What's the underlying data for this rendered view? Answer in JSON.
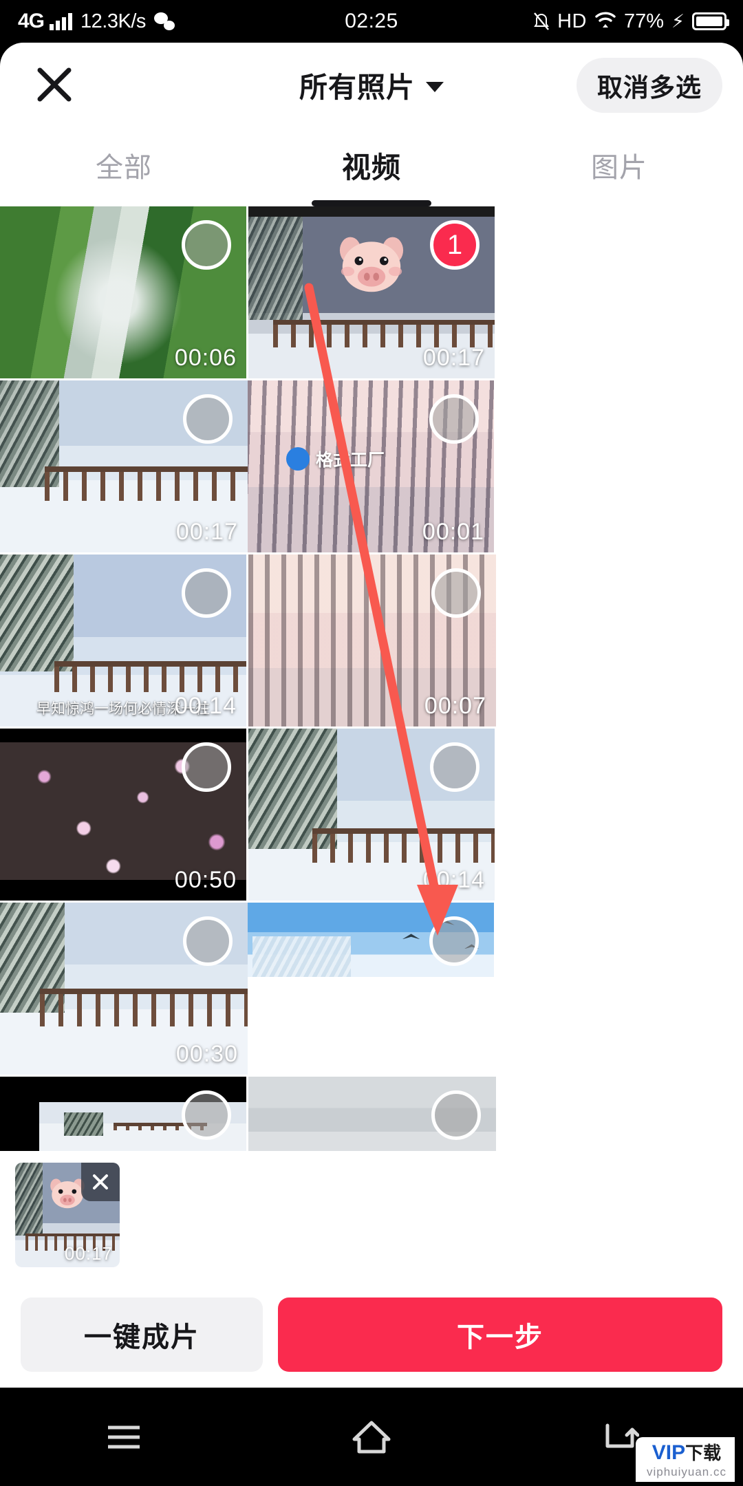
{
  "statusbar": {
    "network": "4G",
    "speed": "12.3K/s",
    "time": "02:25",
    "hd": "HD",
    "battery": "77%",
    "icons": [
      "signal-bars-icon",
      "wechat-icon",
      "mute-icon",
      "wifi-icon",
      "charging-bolt-icon",
      "battery-icon"
    ]
  },
  "header": {
    "close_icon": "close-icon",
    "title": "所有照片",
    "chevron_icon": "chevron-down-icon",
    "multiselect_label": "取消多选"
  },
  "tabs": [
    {
      "label": "全部",
      "active": false
    },
    {
      "label": "视频",
      "active": true
    },
    {
      "label": "图片",
      "active": false
    }
  ],
  "grid": {
    "items": [
      {
        "scene": "waterfall",
        "duration": "00:06",
        "selected": false,
        "badge": ""
      },
      {
        "scene": "snow-bridge-pig",
        "duration": "00:17",
        "selected": true,
        "badge": "1",
        "sticker": "pig-sticker"
      },
      {
        "scene": "snow-railing",
        "duration": "00:17",
        "selected": false,
        "badge": ""
      },
      {
        "scene": "winter-trees-pink",
        "duration": "00:01",
        "selected": false,
        "badge": "",
        "watermark_text": "格式工厂"
      },
      {
        "scene": "snow-bridge-caption",
        "duration": "00:14",
        "selected": false,
        "badge": "",
        "caption": "早知惊鸿一场何必情深一往"
      },
      {
        "scene": "winter-trees-sunset",
        "duration": "00:07",
        "selected": false,
        "badge": ""
      },
      {
        "scene": "pink-blossom-night",
        "duration": "00:50",
        "selected": false,
        "badge": ""
      },
      {
        "scene": "snow-bridge-trees",
        "duration": "00:14",
        "selected": false,
        "badge": ""
      },
      {
        "scene": "snow-railing-wide",
        "duration": "00:30",
        "selected": false,
        "badge": ""
      },
      {
        "scene": "blue-sky-birds",
        "duration": "",
        "selected": false,
        "badge": ""
      },
      {
        "scene": "snow-field-letterbox",
        "duration": "",
        "selected": false,
        "badge": ""
      },
      {
        "scene": "grey-sky-clouds",
        "duration": "",
        "selected": false,
        "badge": ""
      }
    ]
  },
  "selected_strip": {
    "items": [
      {
        "scene": "snow-bridge-pig",
        "duration": "00:17",
        "remove_icon": "close-icon"
      }
    ]
  },
  "actions": {
    "secondary_label": "一键成片",
    "primary_label": "下一步"
  },
  "navbar": {
    "items": [
      "menu-icon",
      "home-icon",
      "back-icon"
    ]
  },
  "annotation": {
    "arrow_color": "#f8594f",
    "type": "pointer-arrow"
  },
  "watermark": {
    "brand": "VIP",
    "brand_cn": "下载",
    "site": "viphuiyuan.cc"
  },
  "colors": {
    "accent_red": "#fa2b4e",
    "dark_text": "#17171a",
    "muted_text": "#a3a3ab",
    "chip_bg": "#f0f0f2"
  }
}
